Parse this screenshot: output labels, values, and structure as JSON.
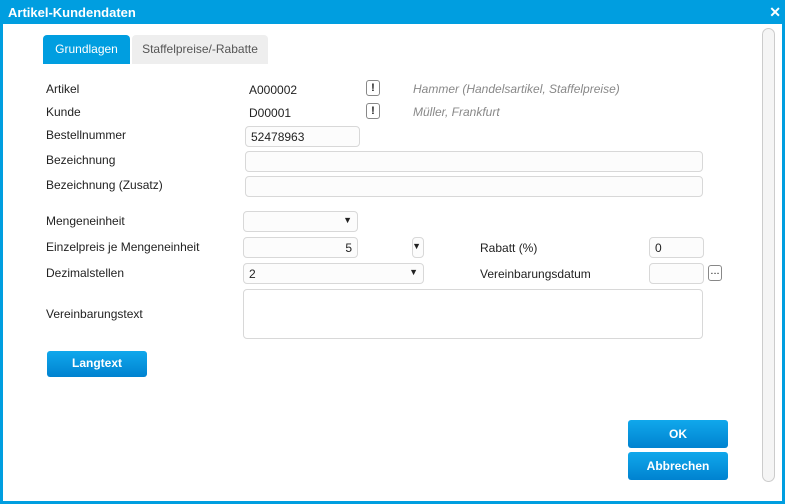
{
  "window": {
    "title": "Artikel-Kundendaten"
  },
  "tabs": [
    {
      "label": "Grundlagen"
    },
    {
      "label": "Staffelpreise/-Rabatte"
    }
  ],
  "form": {
    "artikel": {
      "label": "Artikel",
      "value": "A000002",
      "info": "Hammer (Handelsartikel, Staffelpreise)",
      "button": "!"
    },
    "kunde": {
      "label": "Kunde",
      "value": "D00001",
      "info": "Müller, Frankfurt",
      "button": "!"
    },
    "bestellnummer": {
      "label": "Bestellnummer",
      "value": "52478963"
    },
    "bezeichnung": {
      "label": "Bezeichnung",
      "value": ""
    },
    "bezeichnung_zusatz": {
      "label": "Bezeichnung (Zusatz)",
      "value": ""
    },
    "mengeneinheit": {
      "label": "Mengeneinheit",
      "value": ""
    },
    "einzelpreis": {
      "label": "Einzelpreis je Mengeneinheit",
      "value": "5"
    },
    "rabatt": {
      "label": "Rabatt (%)",
      "value": "0"
    },
    "dezimalstellen": {
      "label": "Dezimalstellen",
      "value": "2"
    },
    "vereinbarungsdatum": {
      "label": "Vereinbarungsdatum",
      "value": "",
      "button": "..."
    },
    "vereinbarungstext": {
      "label": "Vereinbarungstext",
      "value": ""
    }
  },
  "buttons": {
    "langtext": "Langtext",
    "ok": "OK",
    "cancel": "Abbrechen"
  },
  "colors": {
    "accent": "#009ee0"
  }
}
